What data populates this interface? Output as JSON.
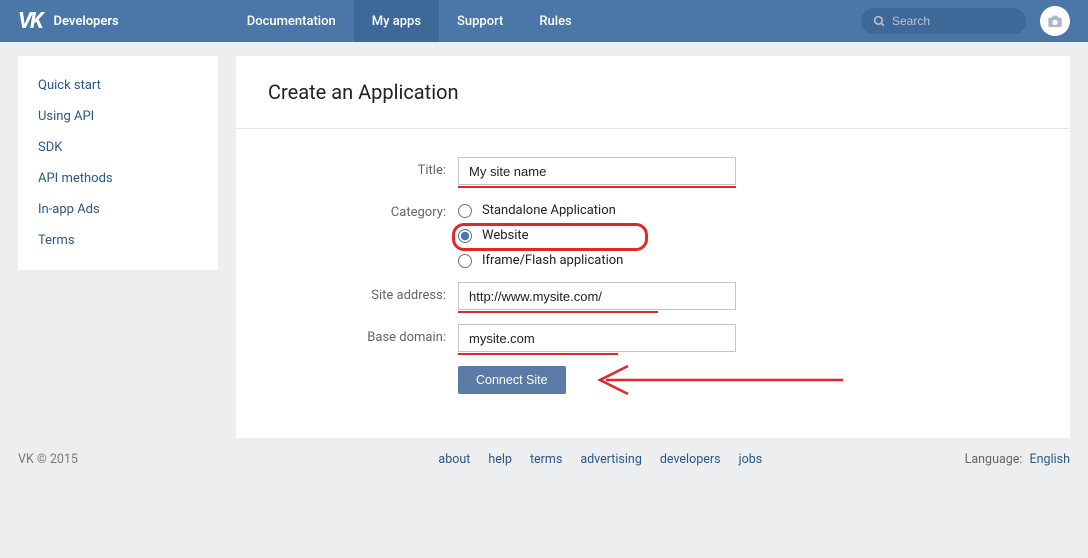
{
  "header": {
    "brand": "Developers",
    "nav": [
      {
        "label": "Documentation",
        "active": false
      },
      {
        "label": "My apps",
        "active": true
      },
      {
        "label": "Support",
        "active": false
      },
      {
        "label": "Rules",
        "active": false
      }
    ],
    "search_placeholder": "Search"
  },
  "sidebar": {
    "items": [
      {
        "label": "Quick start"
      },
      {
        "label": "Using API"
      },
      {
        "label": "SDK"
      },
      {
        "label": "API methods"
      },
      {
        "label": "In-app Ads"
      },
      {
        "label": "Terms"
      }
    ]
  },
  "main": {
    "title": "Create an Application",
    "labels": {
      "title": "Title:",
      "category": "Category:",
      "site_address": "Site address:",
      "base_domain": "Base domain:"
    },
    "fields": {
      "title_value": "My site name",
      "site_address_value": "http://www.mysite.com/",
      "base_domain_value": "mysite.com"
    },
    "category_options": [
      {
        "label": "Standalone Application",
        "selected": false
      },
      {
        "label": "Website",
        "selected": true
      },
      {
        "label": "Iframe/Flash application",
        "selected": false
      }
    ],
    "submit_label": "Connect Site"
  },
  "footer": {
    "copyright": "VK © 2015",
    "links": [
      {
        "label": "about"
      },
      {
        "label": "help"
      },
      {
        "label": "terms"
      },
      {
        "label": "advertising"
      },
      {
        "label": "developers"
      },
      {
        "label": "jobs"
      }
    ],
    "language_label": "Language:",
    "language_value": "English"
  },
  "colors": {
    "header_bg": "#4a76a8",
    "header_active": "#3e6898",
    "link": "#2a5885",
    "annotation": "#e02828"
  }
}
